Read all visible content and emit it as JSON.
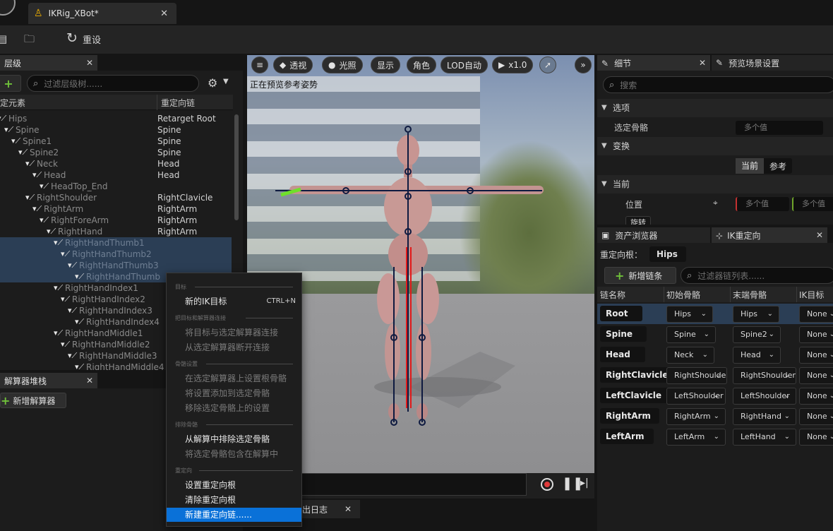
{
  "window": {
    "tab_title": "IKRig_XBot*",
    "reset_label": "重设"
  },
  "hierarchy": {
    "tab_label": "层级",
    "search_placeholder": "过滤层级树......",
    "col_element": "定元素",
    "col_chain": "重定向链",
    "rows": [
      {
        "name": "Hips",
        "chain": "Retarget Root"
      },
      {
        "name": "Spine",
        "chain": "Spine"
      },
      {
        "name": "Spine1",
        "chain": "Spine"
      },
      {
        "name": "Spine2",
        "chain": "Spine"
      },
      {
        "name": "Neck",
        "chain": "Head"
      },
      {
        "name": "Head",
        "chain": "Head"
      },
      {
        "name": "HeadTop_End",
        "chain": ""
      },
      {
        "name": "RightShoulder",
        "chain": "RightClavicle"
      },
      {
        "name": "RightArm",
        "chain": "RightArm"
      },
      {
        "name": "RightForeArm",
        "chain": "RightArm"
      },
      {
        "name": "RightHand",
        "chain": "RightArm"
      },
      {
        "name": "RightHandThumb1",
        "chain": ""
      },
      {
        "name": "RightHandThumb2",
        "chain": ""
      },
      {
        "name": "RightHandThumb3",
        "chain": ""
      },
      {
        "name": "RightHandThumb",
        "chain": ""
      },
      {
        "name": "RightHandIndex1",
        "chain": ""
      },
      {
        "name": "RightHandIndex2",
        "chain": ""
      },
      {
        "name": "RightHandIndex3",
        "chain": ""
      },
      {
        "name": "RightHandIndex4",
        "chain": ""
      },
      {
        "name": "RightHandMiddle1",
        "chain": ""
      },
      {
        "name": "RightHandMiddle2",
        "chain": ""
      },
      {
        "name": "RightHandMiddle3",
        "chain": ""
      },
      {
        "name": "RightHandMiddle4",
        "chain": ""
      }
    ]
  },
  "solver": {
    "tab_label": "解算器堆栈",
    "add_label": "新增解算器"
  },
  "viewport": {
    "perspective": "透视",
    "lighting": "光照",
    "show": "显示",
    "character": "角色",
    "lod": "LOD自动",
    "speed": "x1.0",
    "preview_text": "正在预览参考姿势",
    "log_tab": "出日志"
  },
  "details": {
    "tab_label": "细节",
    "tab2_label": "预览场景设置",
    "search_placeholder": "搜索",
    "sec_options": "选项",
    "selected_bone_label": "选定骨骼",
    "multi_value": "多个值",
    "sec_transform": "变换",
    "current_btn": "当前",
    "reference_btn": "参考",
    "sec_current": "当前",
    "position_label": "位置",
    "rotation_label": "旋转"
  },
  "retarget": {
    "tab1_label": "资产浏览器",
    "tab2_label": "IK重定向",
    "root_label": "重定向根：",
    "root_value": "Hips",
    "add_chain": "新增链条",
    "filter_placeholder": "过滤器链列表......",
    "col_name": "链名称",
    "col_start": "初始骨骼",
    "col_end": "末端骨骼",
    "col_ik": "IK目标",
    "chains": [
      {
        "name": "Root",
        "start": "Hips",
        "end": "Hips",
        "ik": "None"
      },
      {
        "name": "Spine",
        "start": "Spine",
        "end": "Spine2",
        "ik": "None"
      },
      {
        "name": "Head",
        "start": "Neck",
        "end": "Head",
        "ik": "None"
      },
      {
        "name": "RightClavicle",
        "start": "RightShoulder",
        "end": "RightShoulder",
        "ik": "None"
      },
      {
        "name": "LeftClavicle",
        "start": "LeftShoulder",
        "end": "LeftShoulder",
        "ik": "None"
      },
      {
        "name": "RightArm",
        "start": "RightArm",
        "end": "RightHand",
        "ik": "None"
      },
      {
        "name": "LeftArm",
        "start": "LeftArm",
        "end": "LeftHand",
        "ik": "None"
      }
    ]
  },
  "context_menu": {
    "sec_target": "目标",
    "new_ik_goal": "新的IK目标",
    "new_ik_goal_shortcut": "CTRL+N",
    "sec_goal_solver": "把目标和解算器连接",
    "connect_goal": "将目标与选定解算器连接",
    "disconnect_goal": "从选定解算器断开连接",
    "sec_bone_settings": "骨骼设置",
    "set_root_bone": "在选定解算器上设置根骨骼",
    "add_settings": "将设置添加到选定骨骼",
    "remove_settings": "移除选定骨骼上的设置",
    "sec_exclude": "排除骨骼",
    "exclude_bones": "从解算中排除选定骨骼",
    "include_bones": "将选定骨骼包含在解算中",
    "sec_retarget": "重定向",
    "set_retarget_root": "设置重定向根",
    "clear_retarget_root": "清除重定向根",
    "new_retarget_chain": "新建重定向链......"
  }
}
